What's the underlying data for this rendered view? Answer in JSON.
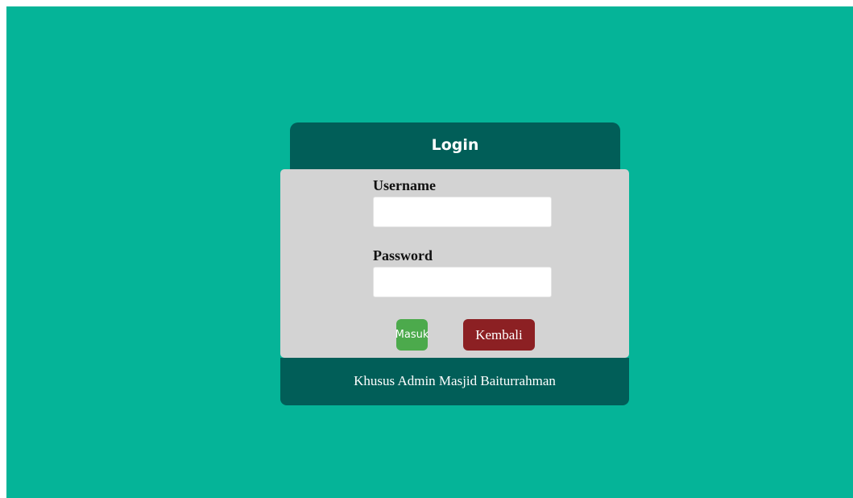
{
  "login": {
    "title": "Login",
    "username_label": "Username",
    "username_value": "",
    "password_label": "Password",
    "password_value": "",
    "submit_label": "Masuk",
    "back_label": "Kembali",
    "footer_text": "Khusus Admin Masjid Baiturrahman"
  },
  "colors": {
    "background": "#05b498",
    "header_footer": "#015e58",
    "panel": "#d3d3d3",
    "submit_button": "#4caa4c",
    "back_button": "#8c2023"
  }
}
